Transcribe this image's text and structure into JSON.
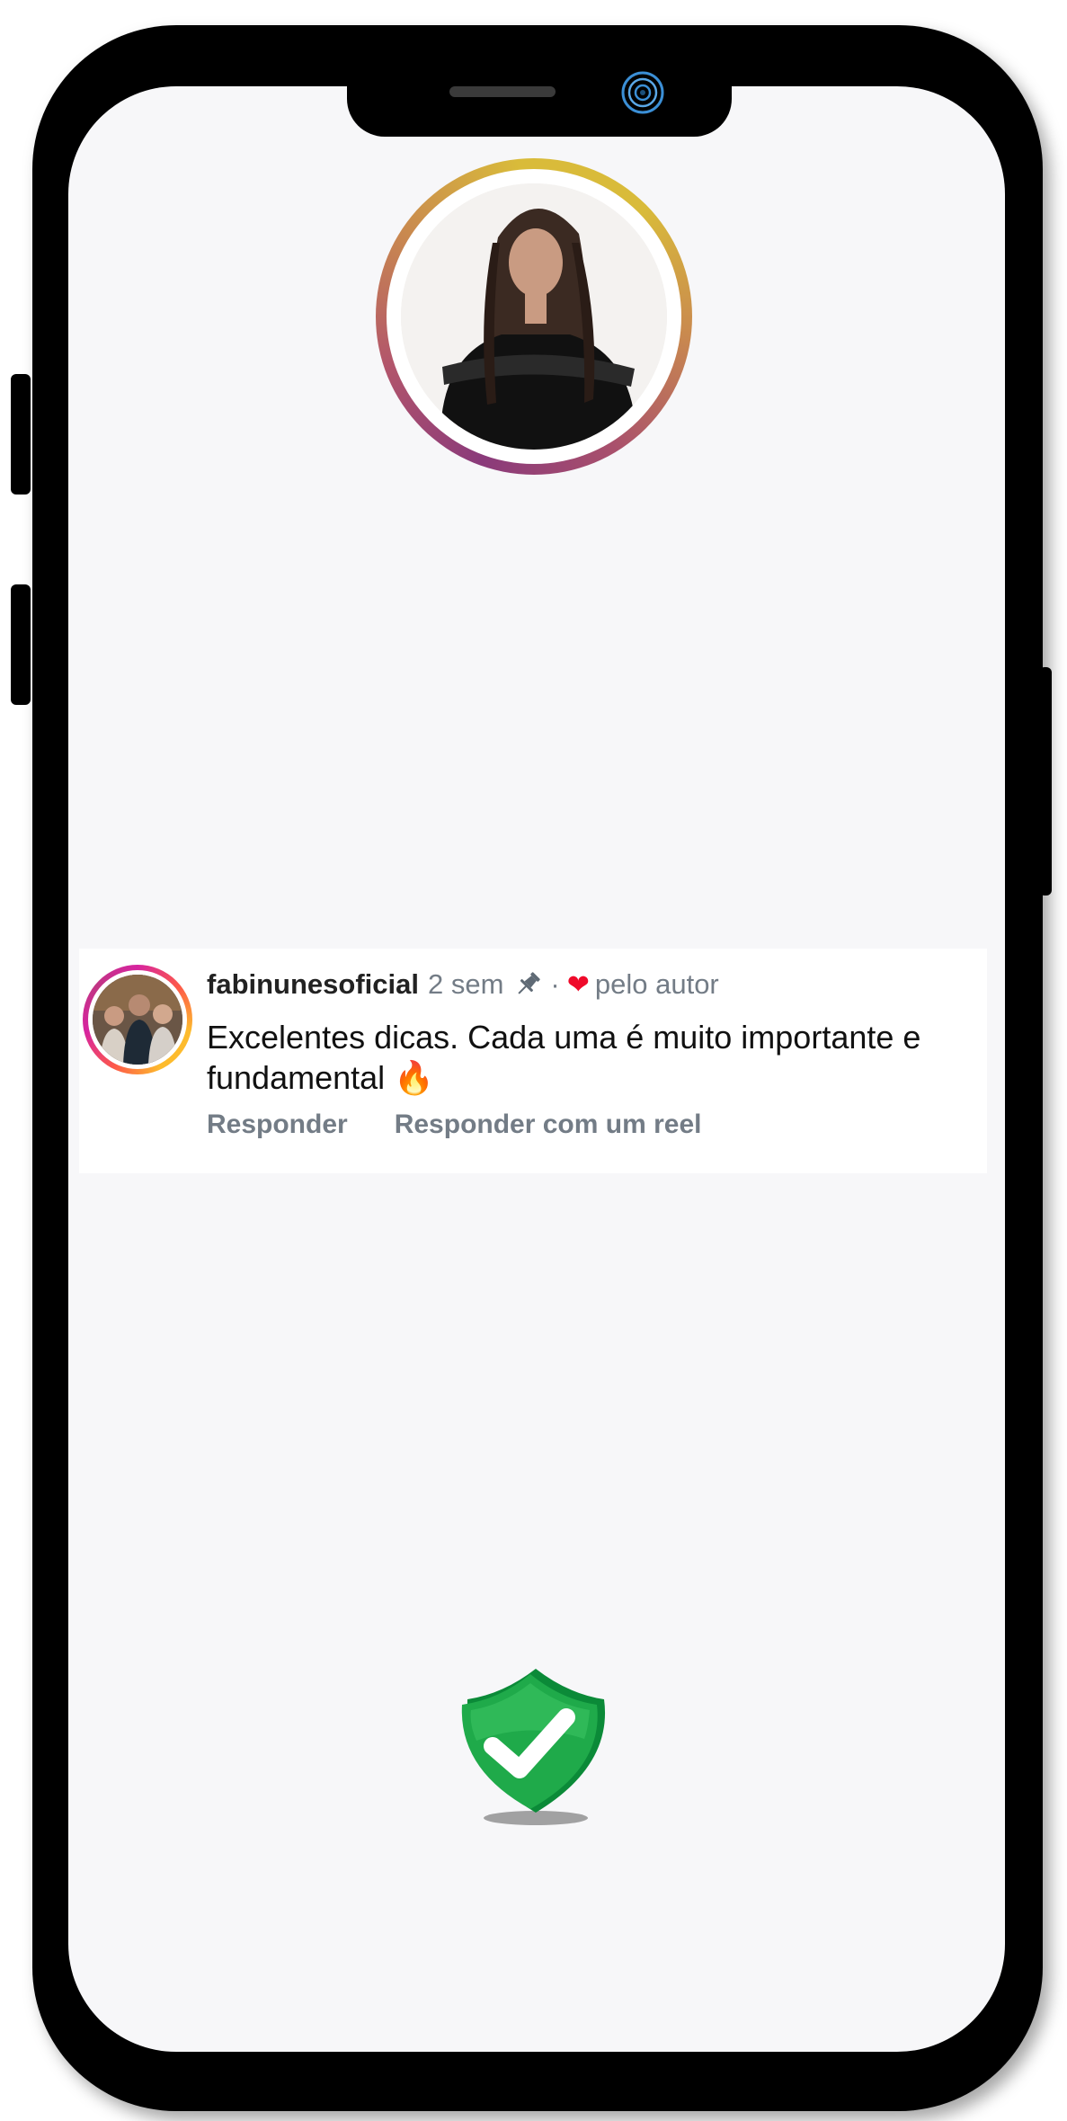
{
  "story": {
    "ring_colors": [
      "#8a3a7a",
      "#d9bb3a"
    ]
  },
  "comment": {
    "username": "fabinunesoficial",
    "time": "2 sem",
    "dot": "·",
    "liked_by": "pelo autor",
    "text": "Excelentes dicas. Cada uma é muito importante e fundamental",
    "emoji": "🔥",
    "reply_label": "Responder",
    "reply_reel_label": "Responder com um reel",
    "icons": [
      "pin-icon",
      "heart-icon"
    ]
  },
  "badge": {
    "icon": "shield-check-icon",
    "color": "#1faa4a"
  }
}
